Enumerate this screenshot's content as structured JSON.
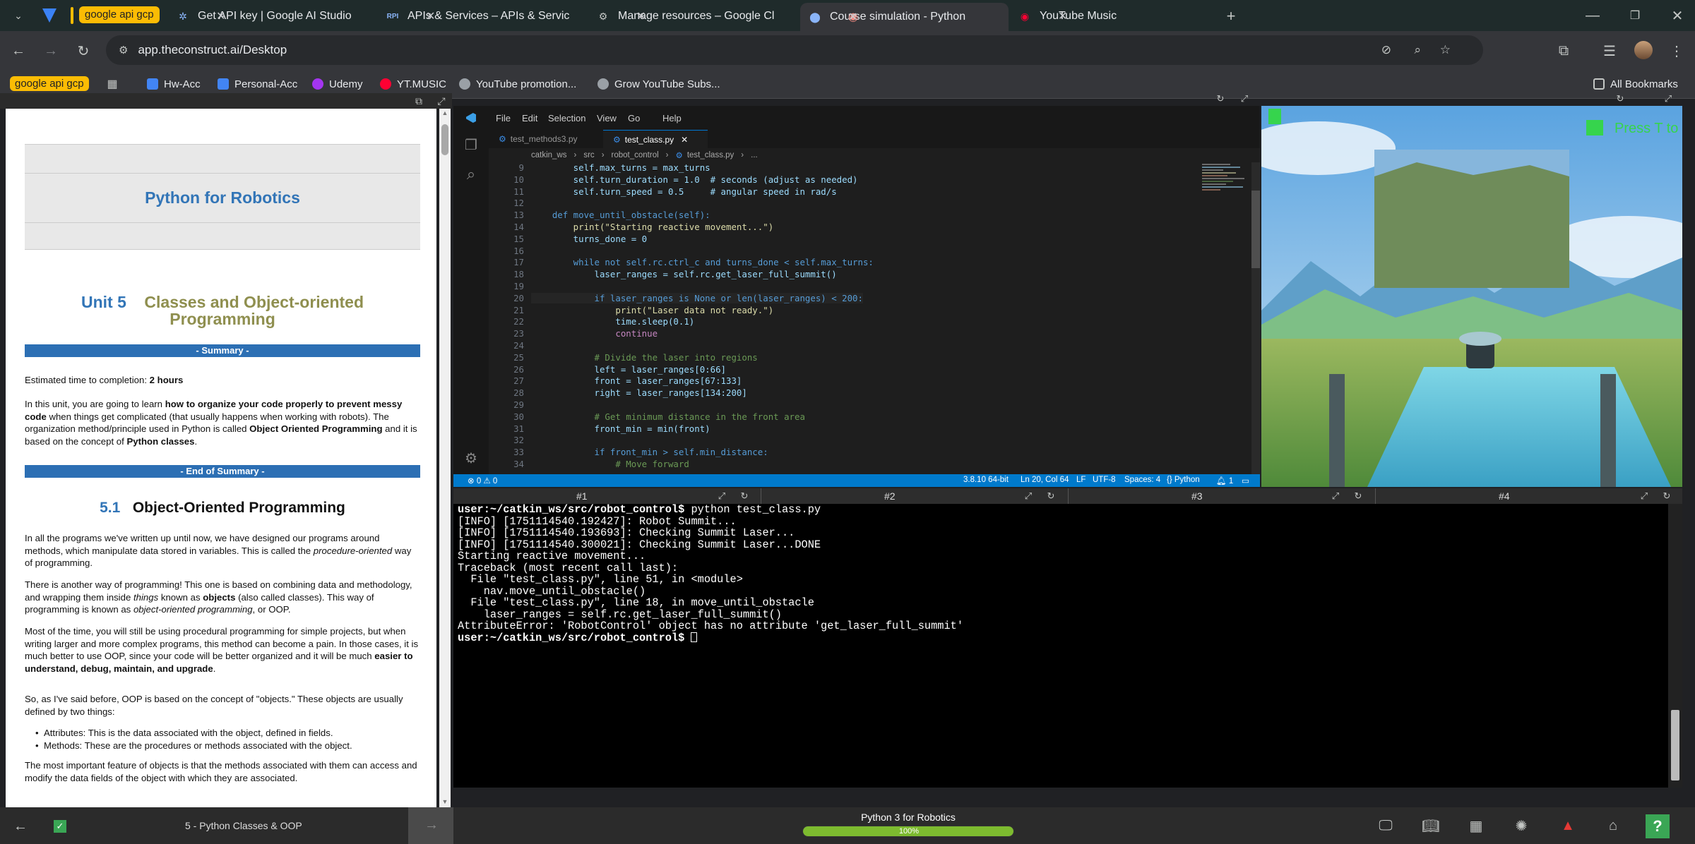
{
  "browser": {
    "tab_group": "google api gcp",
    "tabs": [
      {
        "title": "Get API key | Google AI Studio",
        "icon": "ai-studio-icon"
      },
      {
        "title": "APIs & Services – APIs & Servic",
        "icon": "api-icon"
      },
      {
        "title": "Manage resources – Google Cl",
        "icon": "gear-icon"
      },
      {
        "title": "Course simulation - Python",
        "icon": "construct-icon",
        "active": true
      },
      {
        "title": "YouTube Music",
        "icon": "youtube-music-icon"
      }
    ],
    "url": "app.theconstruct.ai/Desktop",
    "bookmarks": [
      "Hw-Acc",
      "Personal-Acc",
      "Udemy",
      "YT.MUSIC",
      "YouTube promotion...",
      "Grow YouTube Subs..."
    ],
    "all_bookmarks": "All Bookmarks"
  },
  "notebook": {
    "course_title": "Python for Robotics",
    "unit_number": "Unit 5",
    "unit_title_line1": "Classes and Object-oriented",
    "unit_title_line2": "Programming",
    "summary_label": "- Summary -",
    "est_time_label": "Estimated time to completion:",
    "est_time_value": "2 hours",
    "intro_p1": "In this unit, you are going to learn",
    "intro_b1": "how to organize your code properly to prevent messy code",
    "intro_p2": "when things get complicated (that usually happens when working with robots). The organization method/principle used in Python is called",
    "intro_b2": "Object Oriented Programming",
    "intro_p3": "and it is based on the concept of",
    "intro_b3": "Python classes",
    "end_summary_label": "- End of Summary -",
    "section_number": "5.1",
    "section_title": "Object-Oriented Programming",
    "para1_a": "In all the programs we've written up until now, we have designed our programs around methods, which manipulate data stored in variables. This is called the",
    "para1_i": "procedure-oriented",
    "para1_b": "way of programming.",
    "para2_a": "There is another way of programming! This one is based on combining data and methodology, and wrapping them inside",
    "para2_i1": "things",
    "para2_b": "known as",
    "para2_b1": "objects",
    "para2_c": "(also called classes). This way of programming is known as",
    "para2_i2": "object-oriented programming",
    "para2_d": ", or OOP.",
    "para3_a": "Most of the time, you will still be using procedural programming for simple projects, but when writing larger and more complex programs, this method can become a pain. In those cases, it is much better to use OOP, since your code will be better organized and it will be much",
    "para3_b": "easier to understand, debug, maintain, and upgrade",
    "para3_c": ".",
    "para4": "So, as I've said before, OOP is based on the concept of \"objects.\" These objects are usually defined by two things:",
    "bullet1": "Attributes: This is the data associated with the object, defined in fields.",
    "bullet2": "Methods: These are the procedures or methods associated with the object.",
    "para5": "The most important feature of objects is that the methods associated with them can access and modify the data fields of the object with which they are associated.",
    "footer_label": "5 - Python Classes & OOP"
  },
  "vscode": {
    "menu": [
      "File",
      "Edit",
      "Selection",
      "View",
      "Go",
      "Help"
    ],
    "tabs": [
      "test_methods3.py",
      "test_class.py"
    ],
    "breadcrumbs": [
      "catkin_ws",
      "src",
      "robot_control",
      "test_class.py",
      "..."
    ],
    "status": {
      "problems": "⊗ 0 ⚠ 0",
      "python_version": "3.8.10 64-bit",
      "cursor": "Ln 20, Col 64",
      "eol": "LF",
      "encoding": "UTF-8",
      "spaces": "Spaces: 4",
      "language": "Python",
      "notifications": "1"
    },
    "code_lines": [
      {
        "n": "9",
        "t": "        self.max_turns = max_turns"
      },
      {
        "n": "10",
        "t": "        self.turn_duration = 1.0  # seconds (adjust as needed)"
      },
      {
        "n": "11",
        "t": "        self.turn_speed = 0.5     # angular speed in rad/s"
      },
      {
        "n": "12",
        "t": ""
      },
      {
        "n": "13",
        "t": "    def move_until_obstacle(self):"
      },
      {
        "n": "14",
        "t": "        print(\"Starting reactive movement...\")"
      },
      {
        "n": "15",
        "t": "        turns_done = 0"
      },
      {
        "n": "16",
        "t": ""
      },
      {
        "n": "17",
        "t": "        while not self.rc.ctrl_c and turns_done < self.max_turns:"
      },
      {
        "n": "18",
        "t": "            laser_ranges = self.rc.get_laser_full_summit()"
      },
      {
        "n": "19",
        "t": ""
      },
      {
        "n": "20",
        "t": "            if laser_ranges is None or len(laser_ranges) < 200:"
      },
      {
        "n": "21",
        "t": "                print(\"Laser data not ready.\")"
      },
      {
        "n": "22",
        "t": "                time.sleep(0.1)"
      },
      {
        "n": "23",
        "t": "                continue"
      },
      {
        "n": "24",
        "t": ""
      },
      {
        "n": "25",
        "t": "            # Divide the laser into regions"
      },
      {
        "n": "26",
        "t": "            left = laser_ranges[0:66]"
      },
      {
        "n": "27",
        "t": "            front = laser_ranges[67:133]"
      },
      {
        "n": "28",
        "t": "            right = laser_ranges[134:200]"
      },
      {
        "n": "29",
        "t": ""
      },
      {
        "n": "30",
        "t": "            # Get minimum distance in the front area"
      },
      {
        "n": "31",
        "t": "            front_min = min(front)"
      },
      {
        "n": "32",
        "t": ""
      },
      {
        "n": "33",
        "t": "            if front_min > self.min_distance:"
      },
      {
        "n": "34",
        "t": "                # Move forward"
      }
    ]
  },
  "simulation": {
    "overlay_text": "Press T to"
  },
  "terminal": {
    "tabs": [
      "#1",
      "#2",
      "#3",
      "#4"
    ],
    "lines": [
      {
        "prompt": "user:~/catkin_ws/src/robot_control$",
        "text": " python test_class.py"
      },
      {
        "text": "[INFO] [1751114540.192427]: Robot Summit..."
      },
      {
        "text": "[INFO] [1751114540.193693]: Checking Summit Laser..."
      },
      {
        "text": "[INFO] [1751114540.300021]: Checking Summit Laser...DONE"
      },
      {
        "text": "Starting reactive movement..."
      },
      {
        "text": "Traceback (most recent call last):"
      },
      {
        "text": "  File \"test_class.py\", line 51, in <module>"
      },
      {
        "text": "    nav.move_until_obstacle()"
      },
      {
        "text": "  File \"test_class.py\", line 18, in move_until_obstacle"
      },
      {
        "text": "    laser_ranges = self.rc.get_laser_full_summit()"
      },
      {
        "text": "AttributeError: 'RobotControl' object has no attribute 'get_laser_full_summit'"
      },
      {
        "prompt": "user:~/catkin_ws/src/robot_control$",
        "text": " "
      }
    ]
  },
  "bottom": {
    "course_name": "Python 3 for Robotics",
    "progress_percent": 100,
    "progress_label": "100%"
  },
  "colors": {
    "notebook_blue": "#2c6fb4",
    "unit_title": "#8f8f4f",
    "vscode_status": "#007acc",
    "terminal_prompt": "#ffffff",
    "progress": "#7dbb2f"
  }
}
